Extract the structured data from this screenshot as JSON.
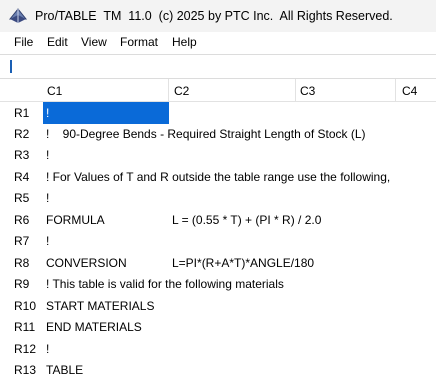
{
  "window": {
    "title": "Pro/TABLE  TM  11.0  (c) 2025 by PTC Inc.  All Rights Reserved.",
    "icon": "pro-table-app-icon"
  },
  "menu": {
    "file": "File",
    "edit": "Edit",
    "view": "View",
    "format": "Format",
    "help": "Help"
  },
  "input": {
    "value": ""
  },
  "columns": {
    "c1": "C1",
    "c2": "C2",
    "c3": "C3",
    "c4": "C4"
  },
  "rows": [
    {
      "label": "R1",
      "c1": "!",
      "c2": ""
    },
    {
      "label": "R2",
      "c1": "!    90-Degree Bends - Required Straight Length of Stock (L)",
      "c2": ""
    },
    {
      "label": "R3",
      "c1": "!",
      "c2": ""
    },
    {
      "label": "R4",
      "c1": "! For Values of T and R outside the table range use the following,",
      "c2": ""
    },
    {
      "label": "R5",
      "c1": "!",
      "c2": ""
    },
    {
      "label": "R6",
      "c1": "FORMULA",
      "c2": "L = (0.55 * T) + (PI * R) / 2.0"
    },
    {
      "label": "R7",
      "c1": "!",
      "c2": ""
    },
    {
      "label": "R8",
      "c1": "CONVERSION",
      "c2": "L=PI*(R+A*T)*ANGLE/180"
    },
    {
      "label": "R9",
      "c1": "! This table is valid for the following materials",
      "c2": ""
    },
    {
      "label": "R10",
      "c1": "START MATERIALS",
      "c2": ""
    },
    {
      "label": "R11",
      "c1": "END MATERIALS",
      "c2": ""
    },
    {
      "label": "R12",
      "c1": "!",
      "c2": ""
    },
    {
      "label": "R13",
      "c1": "TABLE",
      "c2": ""
    }
  ],
  "selection": {
    "cell": "R1C1",
    "color": "#0a6ad8"
  }
}
